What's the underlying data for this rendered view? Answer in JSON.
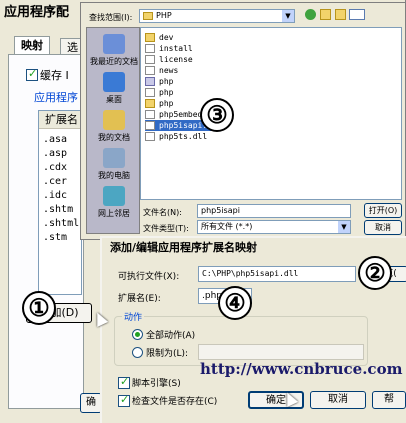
{
  "app_config": {
    "title": "应用程序配",
    "tabs": [
      "映射",
      "选"
    ],
    "cache_checkbox_label": "缓存 I",
    "section_label": "应用程序",
    "list_header": "扩展名",
    "extensions": [
      ".asa",
      ".asp",
      ".cdx",
      ".cer",
      ".idc",
      ".shtm",
      ".shtml",
      ".stm"
    ],
    "add_button": "添加(D)"
  },
  "open_file": {
    "look_in_label": "查找范围(I):",
    "look_in_value": "PHP",
    "places": [
      "我最近的文档",
      "桌面",
      "我的文档",
      "我的电脑",
      "网上邻居"
    ],
    "files": [
      {
        "name": "dev",
        "kind": "folder"
      },
      {
        "name": "install",
        "kind": "doc"
      },
      {
        "name": "license",
        "kind": "doc"
      },
      {
        "name": "news",
        "kind": "doc"
      },
      {
        "name": "php",
        "kind": "php"
      },
      {
        "name": "php",
        "kind": "doc"
      },
      {
        "name": "php",
        "kind": "folder"
      },
      {
        "name": "php5embed",
        "kind": "doc"
      },
      {
        "name": "php5isapi.dll",
        "kind": "doc",
        "selected": true
      },
      {
        "name": "php5ts.dll",
        "kind": "doc"
      }
    ],
    "filename_label": "文件名(N):",
    "filename_value": "php5isapi",
    "filetype_label": "文件类型(T):",
    "filetype_value": "所有文件 (*.*)",
    "open_button": "打开(O)",
    "cancel_button": "取消"
  },
  "mapping_dialog": {
    "title": "添加/编辑应用程序扩展名映射",
    "exe_label": "可执行文件(X):",
    "exe_value": "C:\\PHP\\php5isapi.dll",
    "browse_button": "浏览(",
    "ext_label": "扩展名(E):",
    "ext_value": ".php",
    "verbs_group": "动作",
    "all_verbs": "全部动作(A)",
    "limit_to": "限制为(L):",
    "script_engine": "脚本引擎(S)",
    "check_file": "检查文件是否存在(C)",
    "ok_button": "确定",
    "cancel_button": "取消",
    "help_button": "帮"
  },
  "annotations": [
    "①",
    "②",
    "③",
    "④"
  ],
  "watermark": "http://www.cnbruce.com",
  "bottom_button": "确"
}
